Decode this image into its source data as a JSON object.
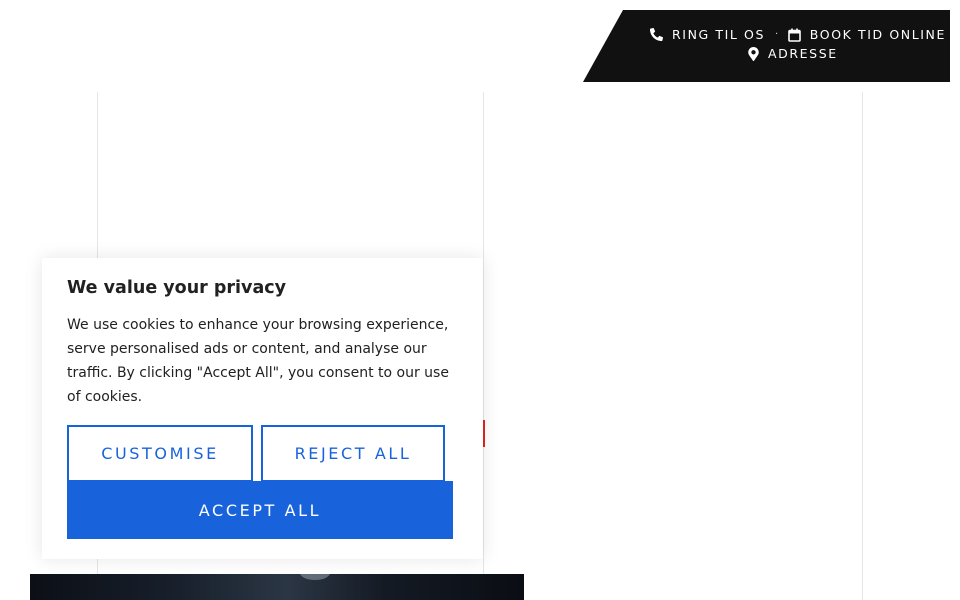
{
  "topbar": {
    "call_label": "RING TIL OS",
    "book_label": "BOOK TID ONLINE",
    "address_label": "ADRESSE",
    "separator": "·",
    "icons": [
      "phone-icon",
      "calendar-icon",
      "map-pin-icon"
    ]
  },
  "cookie": {
    "title": "We value your privacy",
    "text": "We use cookies to enhance your browsing experience, serve personalised ads or content, and analyse our traffic. By clicking \"Accept All\", you consent to our use of cookies.",
    "customise_label": "CUSTOMISE",
    "reject_label": "REJECT ALL",
    "accept_label": "ACCEPT ALL"
  },
  "colors": {
    "primary_blue": "#1863dc",
    "topbar_bg": "#111111",
    "accent_red": "#e32222",
    "text": "#212121"
  }
}
